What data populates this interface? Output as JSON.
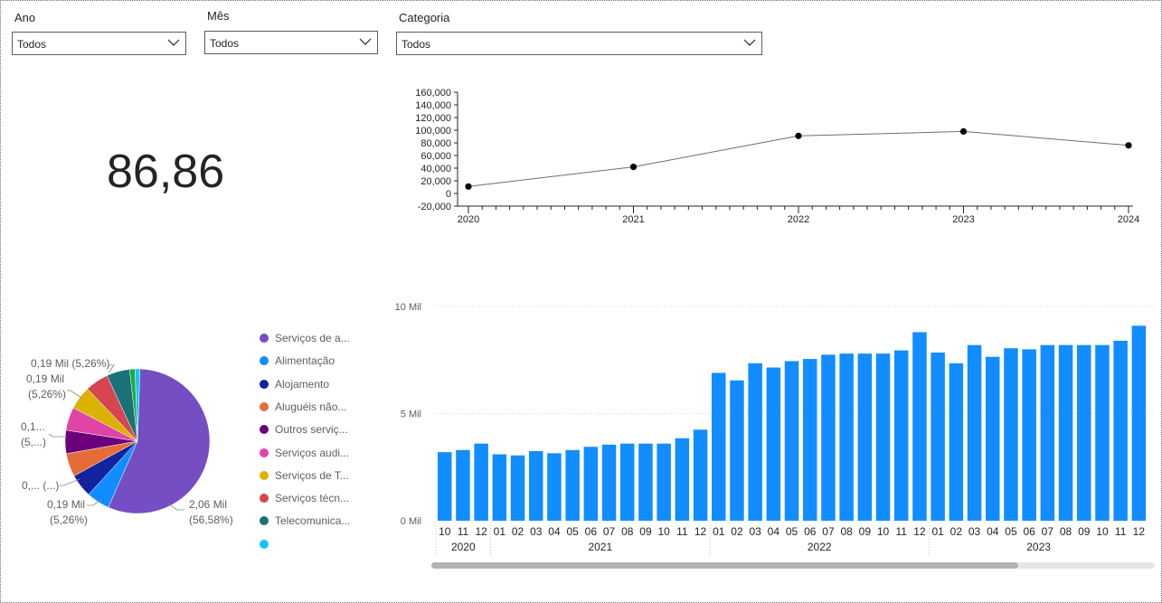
{
  "slicers": {
    "ano": {
      "title": "Ano",
      "value": "Todos"
    },
    "mes": {
      "title": "Mês",
      "value": "Todos"
    },
    "categoria": {
      "title": "Categoria",
      "value": "Todos"
    }
  },
  "kpi": {
    "value": "86,86"
  },
  "colors": {
    "bar": "#118dff",
    "line": "#6e6e6e",
    "point": "#000000",
    "axis_text": "#252423",
    "muted_text": "#605e5c"
  },
  "chart_data": [
    {
      "type": "line",
      "x": [
        "2020",
        "2021",
        "2022",
        "2023",
        "2024"
      ],
      "values": [
        11000,
        42000,
        91000,
        98000,
        76000
      ],
      "ylim": [
        -20000,
        160000
      ],
      "yticks": [
        "160,000",
        "140,000",
        "120,000",
        "100,000",
        "80,000",
        "60,000",
        "40,000",
        "20,000",
        "0",
        "-20,000"
      ],
      "ytick_values": [
        160000,
        140000,
        120000,
        100000,
        80000,
        60000,
        40000,
        20000,
        0,
        -20000
      ],
      "grid": false
    },
    {
      "type": "pie",
      "slices": [
        {
          "label": "Serviços de a...",
          "value": 56.58,
          "color": "#744ec2"
        },
        {
          "label": "Alimentação",
          "value": 5.26,
          "color": "#118dff"
        },
        {
          "label": "Alojamento",
          "value": 5.26,
          "color": "#12239e"
        },
        {
          "label": "Aluguéis não...",
          "value": 5.26,
          "color": "#e66c37"
        },
        {
          "label": "Outros serviç...",
          "value": 5.26,
          "color": "#6b007b"
        },
        {
          "label": "Serviços audi...",
          "value": 5.26,
          "color": "#e044a7"
        },
        {
          "label": "Serviços de T...",
          "value": 5.26,
          "color": "#d9b300"
        },
        {
          "label": "Serviços técn...",
          "value": 5.26,
          "color": "#d64550"
        },
        {
          "label": "Telecomunica...",
          "value": 5.26,
          "color": "#197278"
        },
        {
          "label": "",
          "value": 1.2,
          "color": "#1aab40"
        },
        {
          "label": "",
          "value": 1.1,
          "color": "#15c6f4"
        }
      ],
      "legend_count": 10,
      "data_labels": [
        {
          "lines": [
            "2,06 Mil",
            "(56,58%)"
          ]
        },
        {
          "lines": [
            "0,19 Mil",
            "(5,26%)"
          ]
        },
        {
          "lines": [
            "0,... (...)"
          ]
        },
        {
          "lines": [
            "0,1...",
            "(5,...)"
          ]
        },
        {
          "lines": [
            "0,19 Mil",
            "(5,26%)"
          ]
        },
        {
          "lines": [
            "0,19 Mil (5,26%)"
          ]
        }
      ],
      "legend_placement": "right"
    },
    {
      "type": "bar",
      "months": [
        "10",
        "11",
        "12",
        "01",
        "02",
        "03",
        "04",
        "05",
        "06",
        "07",
        "08",
        "09",
        "10",
        "11",
        "12",
        "01",
        "02",
        "03",
        "04",
        "05",
        "06",
        "07",
        "08",
        "09",
        "10",
        "11",
        "12",
        "01",
        "02",
        "03",
        "04",
        "05",
        "06",
        "07",
        "08",
        "09",
        "10",
        "11",
        "12"
      ],
      "years": [
        {
          "label": "2020",
          "count": 3
        },
        {
          "label": "2021",
          "count": 12
        },
        {
          "label": "2022",
          "count": 12
        },
        {
          "label": "2023",
          "count": 12
        }
      ],
      "values": [
        3.2,
        3.3,
        3.6,
        3.1,
        3.05,
        3.25,
        3.15,
        3.3,
        3.45,
        3.55,
        3.6,
        3.6,
        3.6,
        3.85,
        4.25,
        6.9,
        6.55,
        7.35,
        7.15,
        7.45,
        7.55,
        7.75,
        7.8,
        7.8,
        7.8,
        7.95,
        8.8,
        7.85,
        7.35,
        8.2,
        7.65,
        8.05,
        8.0,
        8.2,
        8.2,
        8.2,
        8.2,
        8.4,
        9.1
      ],
      "ylim": [
        0,
        10
      ],
      "yticks": [
        "10 Mil",
        "5 Mil",
        "0 Mil"
      ],
      "ytick_values": [
        10,
        5,
        0
      ],
      "grid": true
    }
  ]
}
